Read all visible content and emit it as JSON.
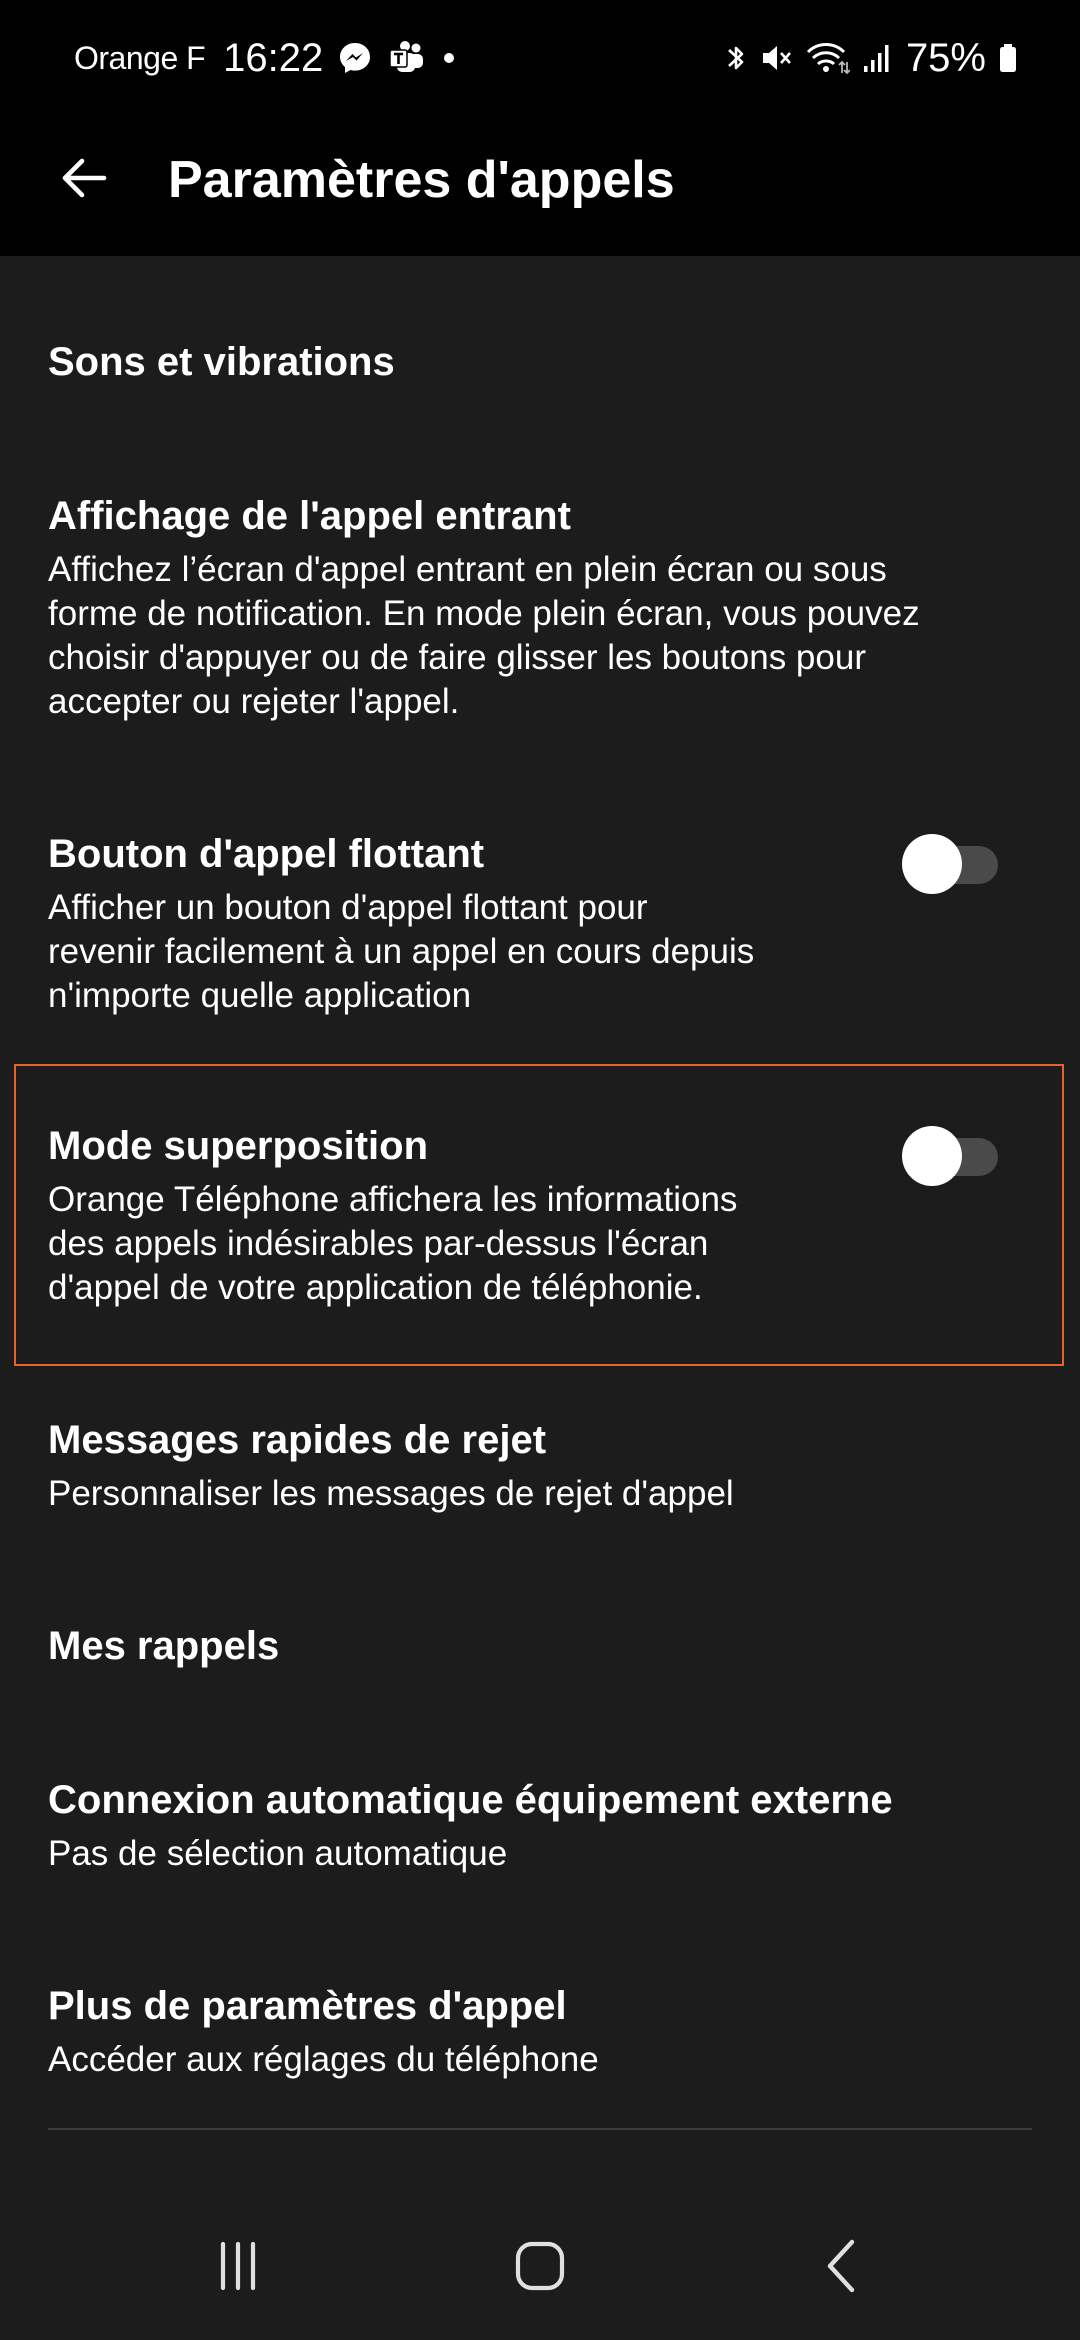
{
  "status_bar": {
    "carrier": "Orange F",
    "time": "16:22",
    "battery_percent": "75%",
    "icons_left": [
      "messenger-icon",
      "teams-icon",
      "dot-icon"
    ],
    "icons_right": [
      "bluetooth-icon",
      "mute-icon",
      "wifi-icon",
      "signal-icon",
      "battery-icon"
    ]
  },
  "app_bar": {
    "title": "Paramètres d'appels",
    "back_icon": "arrow-left-icon"
  },
  "sections": {
    "sounds": "Sons et vibrations",
    "incoming_display": {
      "title": "Affichage de l'appel entrant",
      "desc": [
        "Affichez l’écran d'appel entrant en plein écran ou sous",
        "forme de notification. En mode plein écran, vous pouvez",
        "choisir d'appuyer ou de faire glisser les boutons pour",
        "accepter ou rejeter l'appel."
      ]
    },
    "floating_button": {
      "title": "Bouton d'appel flottant",
      "desc": [
        "Afficher un bouton d'appel flottant pour",
        "revenir facilement à un appel en cours depuis",
        "n'importe quelle application"
      ],
      "enabled": false
    },
    "overlay_mode": {
      "title": "Mode superposition",
      "desc": [
        "Orange Téléphone affichera les informations",
        "des appels indésirables par-dessus l'écran",
        "d'appel de votre application de téléphonie."
      ],
      "enabled": false,
      "highlight_color": "#e8632a"
    },
    "quick_reject": {
      "title": "Messages rapides de rejet",
      "desc": "Personnaliser les messages de rejet d'appel"
    },
    "reminders": "Mes rappels",
    "auto_connect": {
      "title": "Connexion automatique équipement externe",
      "desc": "Pas de sélection automatique"
    },
    "more_settings": {
      "title": "Plus de paramètres d'appel",
      "desc": "Accéder aux réglages du téléphone"
    }
  },
  "nav_bar": {
    "icons": [
      "recents-icon",
      "home-icon",
      "back-icon"
    ]
  },
  "colors": {
    "background": "#1c1c1c",
    "bars": "#000000",
    "accent": "#e8632a",
    "toggle_track": "#4a4a4a"
  }
}
